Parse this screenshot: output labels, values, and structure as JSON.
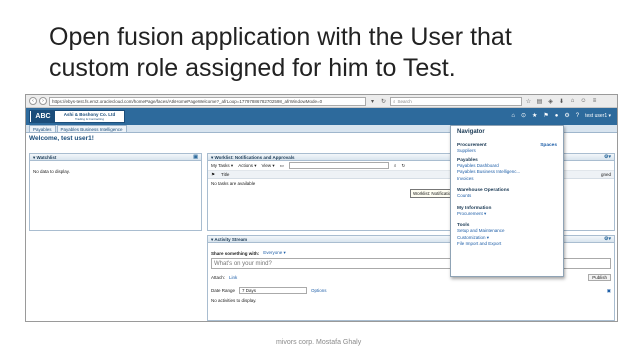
{
  "slide": {
    "title_line1": "Open fusion application with the User that",
    "title_line2": "custom role assigned for him to Test.",
    "footer": "mivors corp. Mostafa Ghaly"
  },
  "browser": {
    "url": "https://ebys-test.fs.em2.oraclecloud.com/homePage/faces/AtkHomePageWelcome?_afrLoop=17797886782702598_afrWindowMode=0",
    "search_placeholder": "Search",
    "back_icon": "back-arrow-icon",
    "forward_icon": "forward-arrow-icon"
  },
  "app": {
    "logo_mark": "ABC",
    "logo_name": "Ashi & Boshony Co. Ltd",
    "logo_tagline": "Trading & Contracting",
    "user_menu": "test user1 ▾",
    "tabs": [
      "Payables",
      "Payables Business Intelligence"
    ],
    "welcome": "Welcome, test user1!"
  },
  "watchlist": {
    "title": "Watchlist",
    "empty": "No data to display."
  },
  "worklist": {
    "title": "Worklist: Notifications and Approvals",
    "my_tasks": "My Tasks ▾",
    "actions": "Actions ▾",
    "view": "View ▾",
    "col_title": "Title",
    "col_right": "gned",
    "empty": "No tasks are available",
    "tooltip": "Worklist: Notifications and Approvals"
  },
  "activity": {
    "title": "Activity Stream",
    "share_label": "Share something with:",
    "share_value": "Everyone ▾",
    "placeholder": "What's on your mind?",
    "attach_label": "Attach:",
    "attach_link": "Link",
    "publish": "Publish",
    "date_range_label": "Date Range",
    "date_range_value": "7 Days",
    "options": "Options",
    "empty": "No activities to display."
  },
  "navigator": {
    "title": "Navigator",
    "sections": [
      {
        "heading": "Procurement",
        "items": [
          "Suppliers"
        ]
      },
      {
        "heading": "Payables",
        "items": [
          "Payables Dashboard",
          "Payables Business Intelligenc...",
          "Invoices"
        ]
      },
      {
        "heading": "Warehouse Operations",
        "items": [
          "Counts"
        ]
      },
      {
        "heading": "My Information",
        "items": [
          "Procurement ▾"
        ]
      },
      {
        "heading": "Tools",
        "items": [
          "Setup and Maintenance",
          "Customization ▾",
          "File Import and Export"
        ]
      }
    ],
    "spaces": "Spaces"
  }
}
